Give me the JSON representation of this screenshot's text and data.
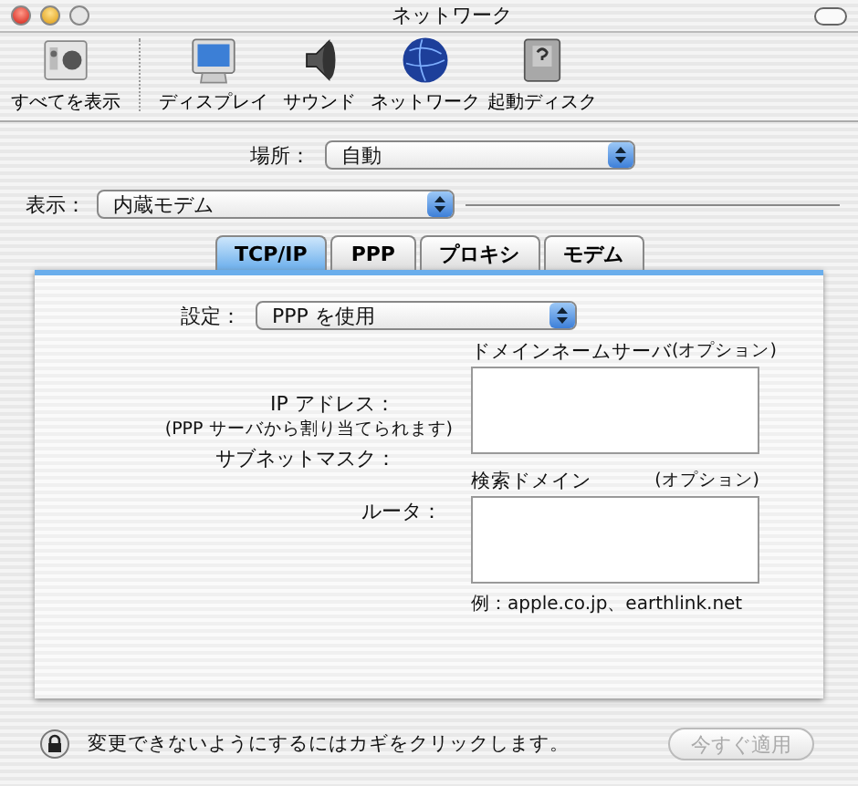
{
  "window": {
    "title": "ネットワーク"
  },
  "toolbar": {
    "items": [
      {
        "label": "すべてを表示"
      },
      {
        "label": "ディスプレイ"
      },
      {
        "label": "サウンド"
      },
      {
        "label": "ネットワーク"
      },
      {
        "label": "起動ディスク"
      }
    ]
  },
  "location": {
    "label": "場所：",
    "value": "自動"
  },
  "show": {
    "label": "表示：",
    "value": "内蔵モデム"
  },
  "tabs": [
    {
      "label": "TCP/IP",
      "selected": true
    },
    {
      "label": "PPP",
      "selected": false
    },
    {
      "label": "プロキシ",
      "selected": false
    },
    {
      "label": "モデム",
      "selected": false
    }
  ],
  "tcpip": {
    "configure": {
      "label": "設定：",
      "value": "PPP を使用"
    },
    "fields": [
      {
        "label": "IP アドレス：",
        "note": "(PPP サーバから割り当てられます)"
      },
      {
        "label": "サブネットマスク："
      },
      {
        "label": "ルータ："
      }
    ],
    "dns": {
      "label": "ドメインネームサーバ",
      "optional": "(オプション)"
    },
    "search_domains": {
      "label": "検索ドメイン",
      "optional": "(オプション)",
      "example": "例：apple.co.jp、earthlink.net"
    }
  },
  "footer": {
    "lock_text": "変更できないようにするにはカギをクリックします。",
    "apply_button": {
      "label": "今すぐ適用",
      "disabled": true
    }
  }
}
